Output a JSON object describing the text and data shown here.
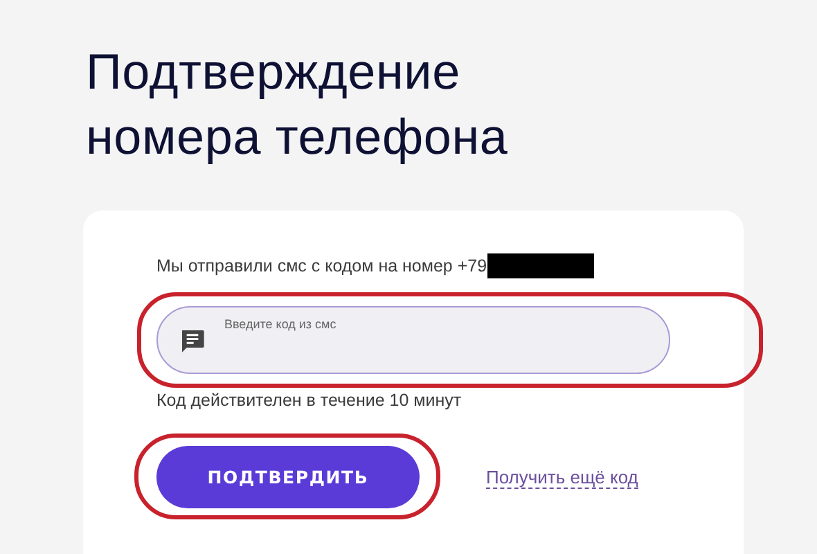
{
  "title": "Подтверждение номера телефона",
  "card": {
    "message": "Мы отправили смс с кодом на номер +79",
    "phone_redacted": true,
    "code_field": {
      "placeholder": "Введите код из смс",
      "highlighted": true
    },
    "hint": "Код действителен в течение 10 минут",
    "confirm_button": {
      "label": "ПОДТВЕРДИТЬ",
      "highlighted": true
    },
    "resend_link": "Получить ещё код"
  }
}
